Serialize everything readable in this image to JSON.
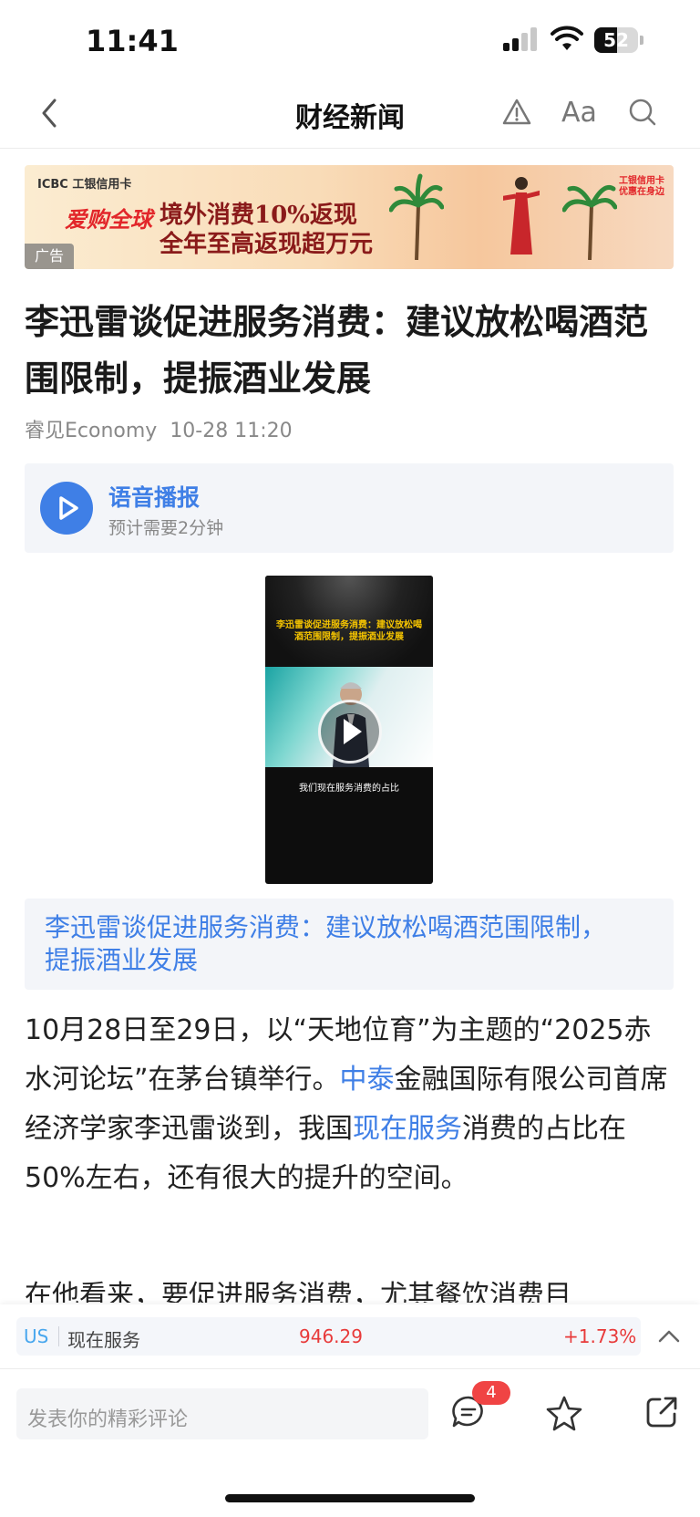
{
  "status_bar": {
    "time": "11:41",
    "battery": "52",
    "battery_level": 0.52
  },
  "nav": {
    "title": "财经新闻",
    "font_label": "Aa"
  },
  "ad": {
    "bank": "ICBC 工银信用卡",
    "logo": "爱购全球",
    "line1": "境外消费10%返现",
    "line2": "全年至高返现超万元",
    "corner": "工银信用卡 优惠在身边",
    "badge": "广告"
  },
  "article": {
    "title": "李迅雷谈促进服务消费：建议放松喝酒范围限制，提振酒业发展",
    "source": "睿见Economy",
    "time": "10-28 11:20",
    "audio": {
      "title": "语音播报",
      "subtitle": "预计需要2分钟"
    },
    "video": {
      "caption_top": "李迅雷谈促进服务消费：建议放松喝酒范围限制，提振酒业发展",
      "subtitle": "我们现在服务消费的占比",
      "title": "李迅雷谈促进服务消费：建议放松喝酒范围限制，提振酒业发展"
    },
    "paragraph1": {
      "part1": "10月28日至29日，以“天地位育”为主题的“2025赤水河论坛”在茅台镇举行。",
      "link1": "中泰",
      "part2": "金融国际有限公司首席经济学家李迅雷谈到，我国",
      "link2": "现在服务",
      "part3": "消费的占比在50%左右，还有很大的提升的空间。"
    },
    "paragraph2": "在他看来，要促进服务消费，尤其餐饮消费目"
  },
  "stock": {
    "market": "US",
    "name": "现在服务",
    "price": "946.29",
    "change": "+1.73%"
  },
  "bottom_bar": {
    "comment_placeholder": "发表你的精彩评论",
    "comment_count": "4"
  },
  "colors": {
    "accent": "#3f7fe6",
    "up": "#e83a3a",
    "badge": "#f04444"
  }
}
